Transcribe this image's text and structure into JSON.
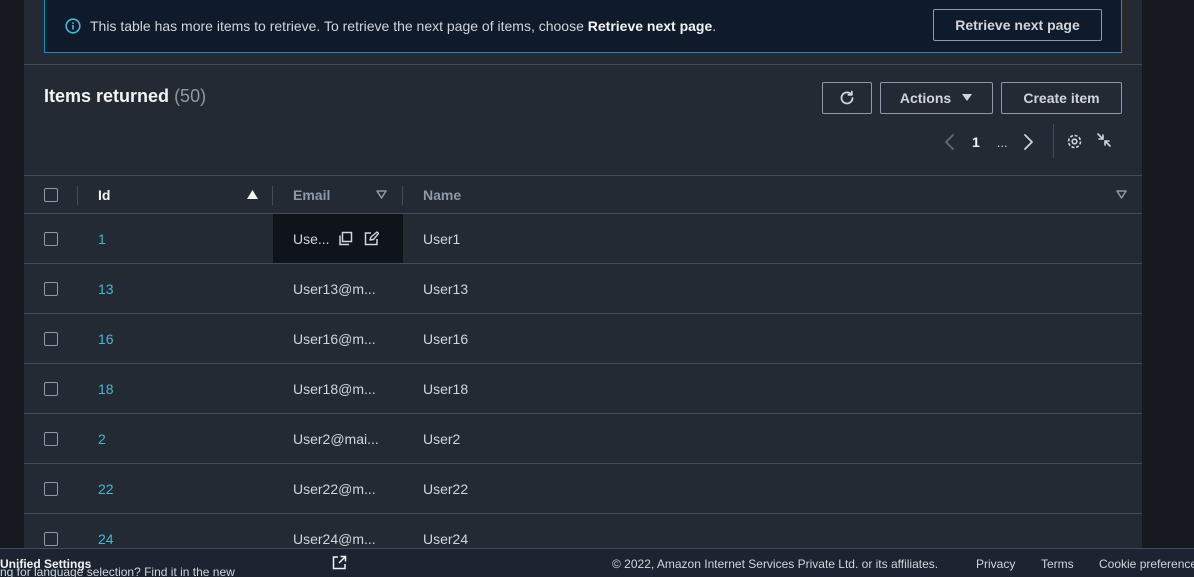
{
  "alert": {
    "text_prefix": "This table has more items to retrieve. To retrieve the next page of items, choose ",
    "text_bold": "Retrieve next page",
    "text_suffix": ".",
    "button_label": "Retrieve next page"
  },
  "header": {
    "title": "Items returned",
    "count": "(50)",
    "actions_label": "Actions",
    "create_label": "Create item"
  },
  "pagination": {
    "current_page": "1",
    "ellipsis": "..."
  },
  "table": {
    "columns": [
      "Id",
      "Email",
      "Name"
    ],
    "rows": [
      {
        "id": "1",
        "email": "Use...",
        "name": "User1"
      },
      {
        "id": "13",
        "email": "User13@m...",
        "name": "User13"
      },
      {
        "id": "16",
        "email": "User16@m...",
        "name": "User16"
      },
      {
        "id": "18",
        "email": "User18@m...",
        "name": "User18"
      },
      {
        "id": "2",
        "email": "User2@mai...",
        "name": "User2"
      },
      {
        "id": "22",
        "email": "User22@m...",
        "name": "User22"
      },
      {
        "id": "24",
        "email": "User24@m...",
        "name": "User24"
      }
    ]
  },
  "footer": {
    "language_text": "ng for language selection? Find it in the new ",
    "unified_settings": "Unified Settings",
    "copyright": "© 2022, Amazon Internet Services Private Ltd. or its affiliates.",
    "privacy": "Privacy",
    "terms": "Terms",
    "cookie": "Cookie preference"
  },
  "colors": {
    "background": "#16191f",
    "panel": "#232a33",
    "link": "#44b9d6",
    "info_border": "#1e8bbf"
  }
}
